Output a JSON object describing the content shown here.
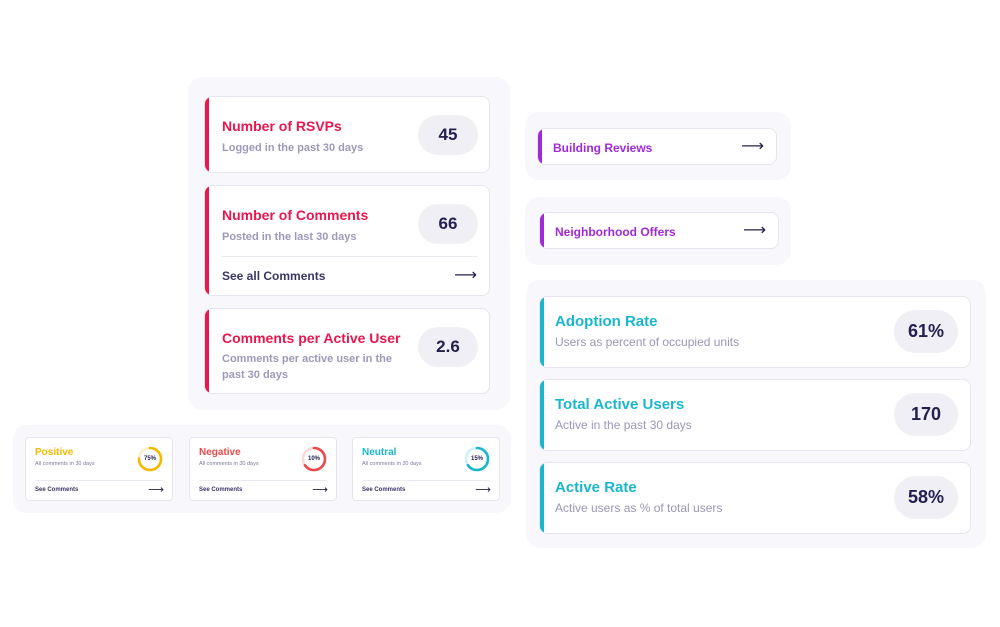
{
  "engagement": {
    "rsvps": {
      "title": "Number of RSVPs",
      "subtitle": "Logged in the past 30 days",
      "value": "45"
    },
    "comments": {
      "title": "Number of Comments",
      "subtitle": "Posted in the last 30 days",
      "value": "66",
      "link": "See all Comments",
      "arrow": "⟶"
    },
    "per_user": {
      "title": "Comments per Active User",
      "subtitle_line1": "Comments per active user in the",
      "subtitle_line2": "past 30 days",
      "value": "2.6"
    }
  },
  "sentiment": [
    {
      "title": "Positive",
      "subtitle": "All comments in 30 days",
      "percent_label": "75%",
      "percent": 75,
      "color": "#f5b800",
      "track": "#fdf0c6",
      "link": "See Comments",
      "arrow": "⟶"
    },
    {
      "title": "Negative",
      "subtitle": "All comments in 30 days",
      "percent_label": "10%",
      "percent": 10,
      "color": "#ea4a4a",
      "track": "#fbd9d9",
      "link": "See Comments",
      "arrow": "⟶"
    },
    {
      "title": "Neutral",
      "subtitle": "All comments in 30 days",
      "percent_label": "15%",
      "percent": 15,
      "color": "#1ab7cc",
      "track": "#cdf1f6",
      "link": "See Comments",
      "arrow": "⟶"
    }
  ],
  "links": [
    {
      "label": "Building Reviews",
      "arrow": "⟶"
    },
    {
      "label": "Neighborhood Offers",
      "arrow": "⟶"
    }
  ],
  "adoption": [
    {
      "title": "Adoption Rate",
      "subtitle": "Users as percent of occupied units",
      "value": "61%"
    },
    {
      "title": "Total Active Users",
      "subtitle": "Active in the past 30 days",
      "value": "170"
    },
    {
      "title": "Active Rate",
      "subtitle": "Active users as % of total users",
      "value": "58%"
    }
  ],
  "colors": {
    "red": "#e8174f",
    "teal": "#1ab7cc",
    "purple": "#a22ad6",
    "navy": "#23204f"
  }
}
